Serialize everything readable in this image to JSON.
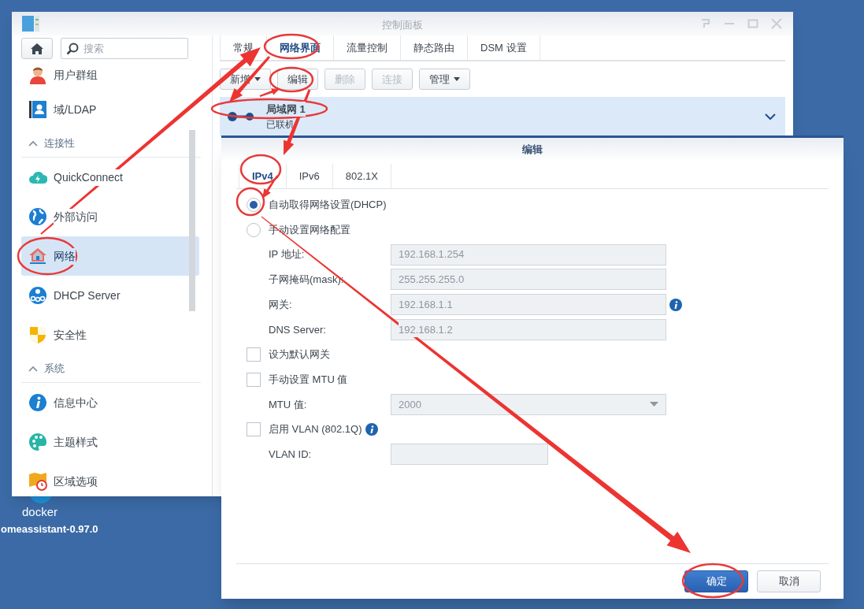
{
  "desktop": {
    "icon_labels": [
      {
        "text": "docker"
      },
      {
        "text": "omeassistant-0.97.0"
      }
    ]
  },
  "control_panel": {
    "title": "控制面板",
    "search": {
      "placeholder": "搜索"
    },
    "sidebar": [
      {
        "kind": "item",
        "label": "用户群组",
        "selected": false
      },
      {
        "kind": "item",
        "label": "域/LDAP",
        "selected": false
      },
      {
        "kind": "section",
        "label": "连接性",
        "expanded": true
      },
      {
        "kind": "item",
        "label": "QuickConnect",
        "selected": false
      },
      {
        "kind": "item",
        "label": "外部访问",
        "selected": false
      },
      {
        "kind": "item",
        "label": "网络",
        "selected": true
      },
      {
        "kind": "item",
        "label": "DHCP Server",
        "selected": false
      },
      {
        "kind": "item",
        "label": "安全性",
        "selected": false
      },
      {
        "kind": "section",
        "label": "系统",
        "expanded": true
      },
      {
        "kind": "item",
        "label": "信息中心",
        "selected": false
      },
      {
        "kind": "item",
        "label": "主题样式",
        "selected": false
      },
      {
        "kind": "item",
        "label": "区域选项",
        "selected": false
      }
    ],
    "tabs": [
      {
        "label": "常规",
        "selected": false
      },
      {
        "label": "网络界面",
        "selected": true
      },
      {
        "label": "流量控制",
        "selected": false
      },
      {
        "label": "静态路由",
        "selected": false
      },
      {
        "label": "DSM 设置",
        "selected": false
      }
    ],
    "toolbar": [
      {
        "label": "新增",
        "dropdown": true,
        "disabled": false
      },
      {
        "label": "编辑",
        "dropdown": false,
        "disabled": false
      },
      {
        "label": "删除",
        "dropdown": false,
        "disabled": true
      },
      {
        "label": "连接",
        "dropdown": false,
        "disabled": true
      },
      {
        "label": "管理",
        "dropdown": true,
        "disabled": false
      }
    ],
    "interfaces": [
      {
        "name": "局域网 1",
        "status": "已联机",
        "selected": true,
        "expanded": false
      }
    ]
  },
  "dialog": {
    "title": "编辑",
    "tabs": [
      {
        "label": "IPv4",
        "selected": true
      },
      {
        "label": "IPv6",
        "selected": false
      },
      {
        "label": "802.1X",
        "selected": false
      }
    ],
    "rows": [
      {
        "kind": "radio",
        "label": "自动取得网络设置(DHCP)",
        "selected": true
      },
      {
        "kind": "radio",
        "label": "手动设置网络配置",
        "selected": false
      },
      {
        "kind": "field",
        "label": "IP 地址:",
        "value": "192.168.1.254",
        "disabled": true
      },
      {
        "kind": "field",
        "label": "子网掩码(mask):",
        "value": "255.255.255.0",
        "disabled": true
      },
      {
        "kind": "field",
        "label": "网关:",
        "value": "192.168.1.1",
        "disabled": true,
        "info": true
      },
      {
        "kind": "field",
        "label": "DNS Server:",
        "value": "192.168.1.2",
        "disabled": true
      },
      {
        "kind": "checkbox",
        "label": "设为默认网关",
        "checked": false
      },
      {
        "kind": "checkbox",
        "label": "手动设置 MTU 值",
        "checked": false
      },
      {
        "kind": "select",
        "label": "MTU 值:",
        "value": "2000",
        "disabled": true
      },
      {
        "kind": "checkbox",
        "label": "启用 VLAN (802.1Q)",
        "checked": false,
        "info": true
      },
      {
        "kind": "narrow_field",
        "label": "VLAN ID:",
        "disabled": true
      }
    ],
    "buttons": [
      {
        "label": "确定",
        "primary": true
      },
      {
        "label": "取消",
        "primary": false
      }
    ]
  }
}
